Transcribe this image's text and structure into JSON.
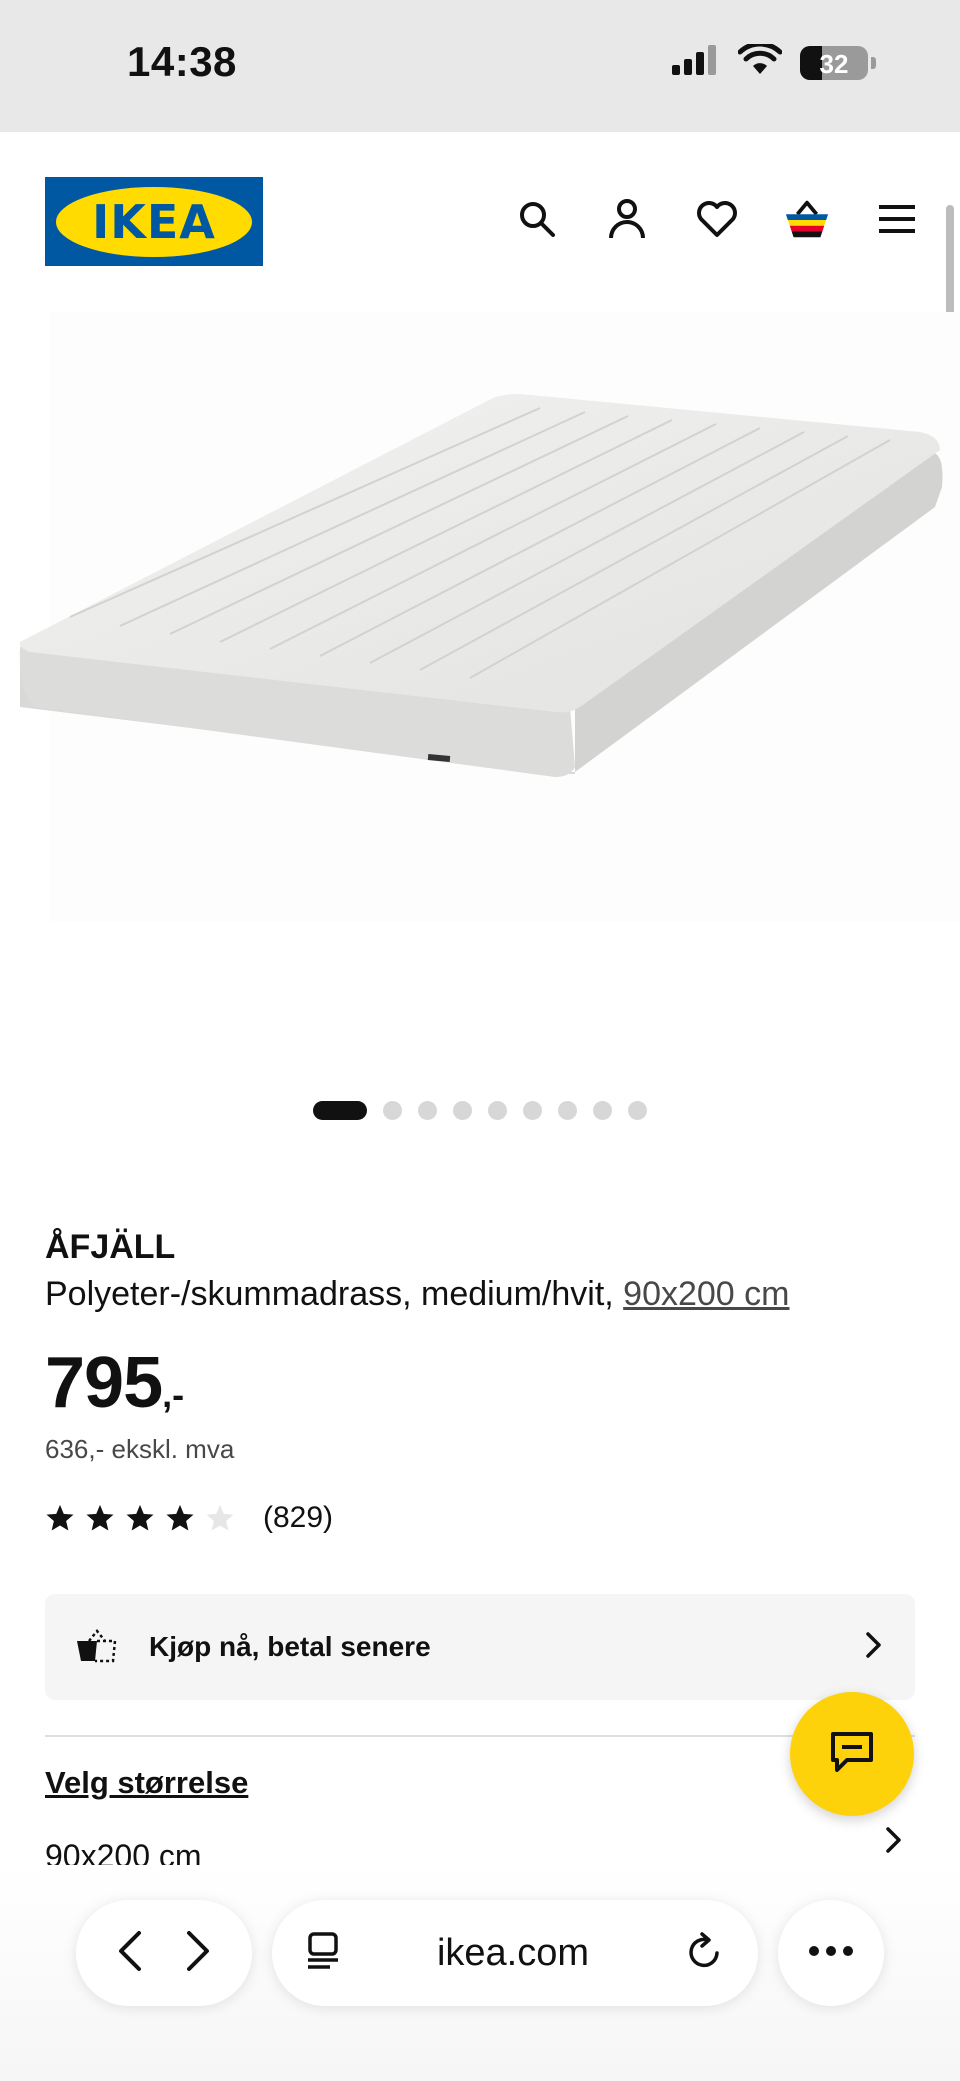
{
  "status_bar": {
    "time": "14:38",
    "battery_level": "32"
  },
  "header": {
    "logo_text": "IKEA",
    "brand_colors": {
      "blue": "#0058a3",
      "yellow": "#ffdb00"
    },
    "icons": [
      "search-icon",
      "user-icon",
      "heart-icon",
      "cart-icon",
      "menu-icon"
    ]
  },
  "gallery": {
    "image_count": 9,
    "active_index": 0
  },
  "product": {
    "name": "ÅFJÄLL",
    "description": "Polyeter-/skummadrass, medium/hvit, ",
    "size_link": "90x200 cm",
    "price": "795",
    "price_suffix": ",-",
    "price_ex_vat": "636,- ekskl. mva",
    "rating": 4,
    "rating_max": 5,
    "review_count": "(829)"
  },
  "bnpl": {
    "label": "Kjøp nå, betal senere"
  },
  "size_selector": {
    "title": "Velg størrelse",
    "value": "90x200 cm"
  },
  "chat": {
    "accent_color": "#fdd20b"
  },
  "browser": {
    "url": "ikea.com"
  }
}
